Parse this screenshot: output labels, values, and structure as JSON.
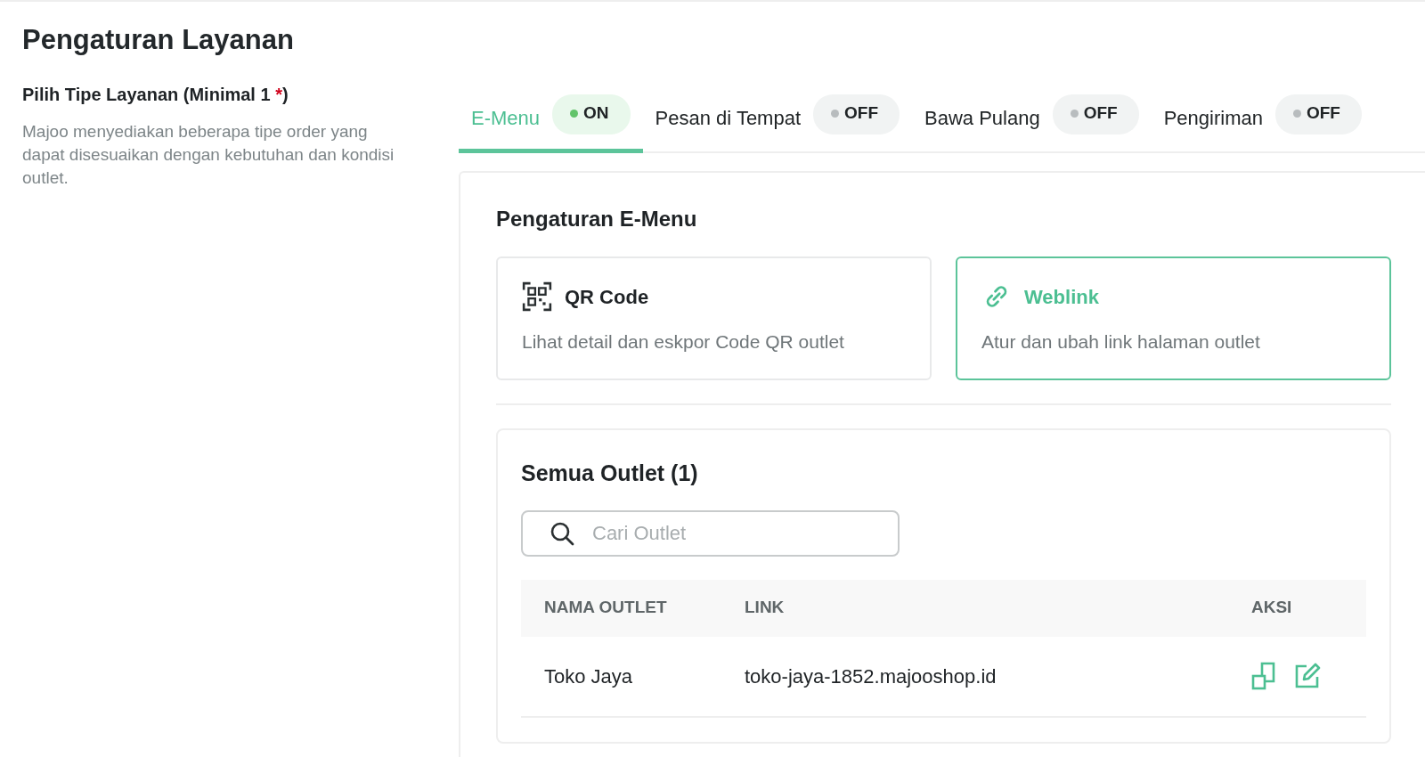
{
  "page_title": "Pengaturan Layanan",
  "service_type": {
    "label": "Pilih Tipe Layanan (Minimal 1 ",
    "required_mark": "*",
    "label_end": ")",
    "description": "Majoo menyediakan beberapa tipe order yang dapat disesuaikan dengan kebutuhan dan kondisi outlet."
  },
  "tabs": [
    {
      "label": "E-Menu",
      "selected": true,
      "status": "ON",
      "on": true
    },
    {
      "label": "Pesan di Tempat",
      "selected": false,
      "status": "OFF",
      "on": false
    },
    {
      "label": "Bawa Pulang",
      "selected": false,
      "status": "OFF",
      "on": false
    },
    {
      "label": "Pengiriman",
      "selected": false,
      "status": "OFF",
      "on": false
    }
  ],
  "panel": {
    "title": "Pengaturan E-Menu",
    "options": [
      {
        "kind": "qr",
        "title": "QR Code",
        "description": "Lihat detail dan eskpor Code QR outlet",
        "selected": false
      },
      {
        "kind": "link",
        "title": "Weblink",
        "description": "Atur dan ubah link halaman outlet",
        "selected": true
      }
    ]
  },
  "outlets": {
    "title": "Semua Outlet (1)",
    "search": {
      "placeholder": "Cari Outlet"
    },
    "table": {
      "columns": [
        "NAMA OUTLET",
        "LINK",
        "AKSI"
      ],
      "rows": [
        {
          "name": "Toko Jaya",
          "link": "toko-jaya-1852.majooshop.id"
        }
      ]
    }
  }
}
